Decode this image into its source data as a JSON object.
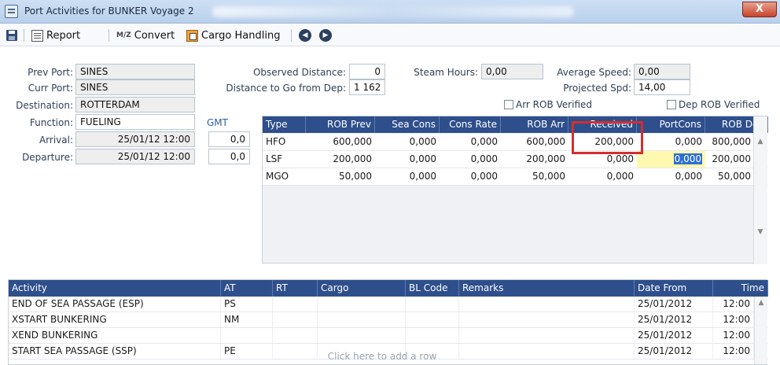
{
  "window": {
    "title": "Port Activities for BUNKER Voyage 2",
    "close_label": "X"
  },
  "toolbar": {
    "report_label": "Report",
    "convert_glyph": "M/Z",
    "convert_label": "Convert",
    "cargo_label": "Cargo Handling",
    "prev_glyph": "◀",
    "next_glyph": "▶"
  },
  "form": {
    "prev_port_label": "Prev Port:",
    "prev_port": "SINES",
    "curr_port_label": "Curr Port:",
    "curr_port": "SINES",
    "destination_label": "Destination:",
    "destination": "ROTTERDAM",
    "function_label": "Function:",
    "function": "FUELING",
    "arrival_label": "Arrival:",
    "arrival": "25/01/12 12:00",
    "departure_label": "Departure:",
    "departure": "25/01/12 12:00",
    "gmt_label": "GMT",
    "arrival_gmt": "0,0",
    "departure_gmt": "0,0",
    "observed_distance_label": "Observed Distance:",
    "observed_distance": "0",
    "distance_to_go_label": "Distance to Go from Dep:",
    "distance_to_go": "1 162",
    "steam_hours_label": "Steam Hours:",
    "steam_hours": "0,00",
    "average_speed_label": "Average Speed:",
    "average_speed": "0,00",
    "projected_spd_label": "Projected Spd:",
    "projected_spd": "14,00",
    "arr_rob_label": "Arr ROB Verified",
    "dep_rob_label": "Dep ROB Verified"
  },
  "rob_table": {
    "headers": [
      "Type",
      "ROB Prev",
      "Sea Cons",
      "Cons Rate",
      "ROB Arr",
      "Received",
      "PortCons",
      "ROB Dep"
    ],
    "rows": [
      [
        "HFO",
        "600,000",
        "0,000",
        "0,000",
        "600,000",
        "200,000",
        "0,000",
        "800,000"
      ],
      [
        "LSF",
        "200,000",
        "0,000",
        "0,000",
        "200,000",
        "0,000",
        "0,000",
        "200,000"
      ],
      [
        "MGO",
        "50,000",
        "0,000",
        "0,000",
        "50,000",
        "0,000",
        "0,000",
        "50,000"
      ]
    ],
    "scroll_up": "▲",
    "scroll_down": "▼"
  },
  "activity_table": {
    "headers": [
      "Activity",
      "AT",
      "RT",
      "Cargo",
      "BL Code",
      "Remarks",
      "Date From",
      "Time"
    ],
    "rows": [
      [
        "END OF SEA PASSAGE (ESP)",
        "PS",
        "",
        "",
        "",
        "",
        "25/01/2012",
        "12:00"
      ],
      [
        "XSTART BUNKERING",
        "NM",
        "",
        "",
        "",
        "",
        "25/01/2012",
        "12:00"
      ],
      [
        "XEND BUNKERING",
        "",
        "",
        "",
        "",
        "",
        "25/01/2012",
        "12:00"
      ],
      [
        "START SEA PASSAGE (SSP)",
        "PE",
        "",
        "",
        "",
        "",
        "25/01/2012",
        "12:00"
      ]
    ],
    "add_row_label": "Click here to add a row",
    "scroll_up": "▲"
  },
  "colors": {
    "header_blue": "#2e4f8c",
    "highlight_red": "#d42e2e",
    "selection_yellow": "#fff9b0"
  }
}
